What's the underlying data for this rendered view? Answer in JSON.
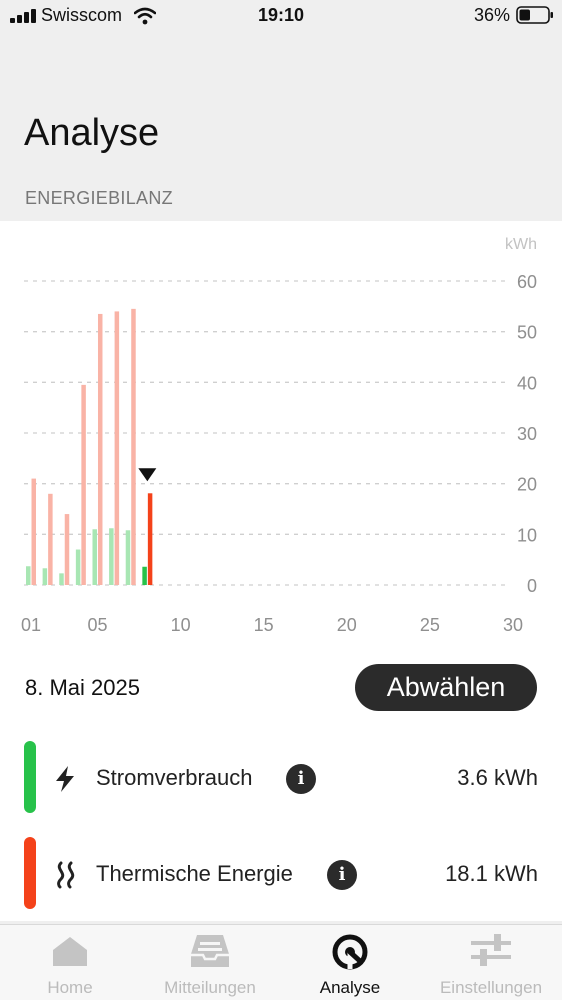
{
  "status_bar": {
    "carrier": "Swisscom",
    "time": "19:10",
    "battery": "36%"
  },
  "header": {
    "title": "Analyse",
    "section": "ENERGIEBILANZ"
  },
  "chart_data": {
    "type": "bar",
    "unit": "kWh",
    "x": [
      1,
      2,
      3,
      4,
      5,
      6,
      7,
      8
    ],
    "xticks": [
      "01",
      "05",
      "10",
      "15",
      "20",
      "25",
      "30"
    ],
    "xtick_values": [
      1,
      5,
      10,
      15,
      20,
      25,
      30
    ],
    "xlim": [
      1,
      30
    ],
    "yticks": [
      0,
      10,
      20,
      30,
      40,
      50,
      60
    ],
    "ylim": [
      0,
      60
    ],
    "grid": true,
    "series": [
      {
        "key": "strom",
        "values": [
          3.7,
          3.3,
          2.3,
          7.0,
          11.0,
          11.2,
          10.8,
          3.6
        ],
        "color": "#a8e6b3",
        "selected_color": "#27c24a"
      },
      {
        "key": "thermisch",
        "values": [
          21.0,
          18.0,
          14.0,
          39.5,
          53.5,
          54.0,
          54.5,
          18.1
        ],
        "color": "#f9b3a6",
        "selected_color": "#f4421a"
      }
    ],
    "selected_index": 7
  },
  "selection": {
    "date": "8. Mai 2025",
    "deselect_label": "Abwählen"
  },
  "energy_items": [
    {
      "label": "Stromverbrauch",
      "value": "3.6 kWh",
      "color": "#27c24a",
      "icon": "lightning-icon"
    },
    {
      "label": "Thermische Energie",
      "value": "18.1 kWh",
      "color": "#f4421a",
      "icon": "heat-waves-icon"
    }
  ],
  "tab_bar": [
    {
      "label": "Home",
      "icon": "house-icon",
      "active": false
    },
    {
      "label": "Mitteilungen",
      "icon": "inbox-icon",
      "active": false
    },
    {
      "label": "Analyse",
      "icon": "analysis-icon",
      "active": true
    },
    {
      "label": "Einstellungen",
      "icon": "sliders-icon",
      "active": false
    }
  ]
}
